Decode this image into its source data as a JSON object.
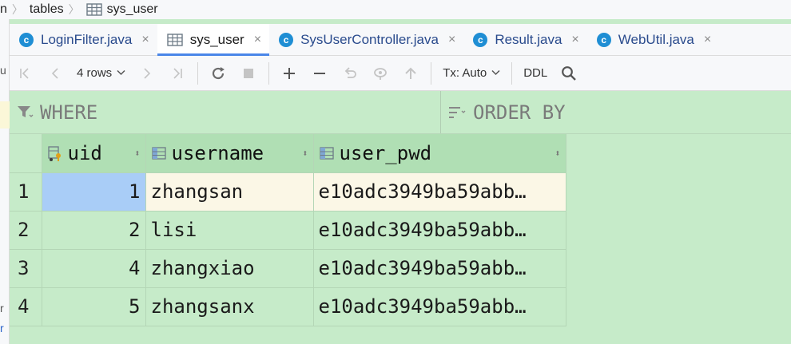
{
  "breadcrumb": {
    "items": [
      "n",
      "tables",
      "sys_user"
    ]
  },
  "tabs": [
    {
      "label": "LoginFilter.java",
      "icon": "c-class-icon",
      "active": false
    },
    {
      "label": "sys_user",
      "icon": "table-icon",
      "active": true
    },
    {
      "label": "SysUserController.java",
      "icon": "c-class-icon",
      "active": false
    },
    {
      "label": "Result.java",
      "icon": "c-class-icon",
      "active": false
    },
    {
      "label": "WebUtil.java",
      "icon": "c-class-icon",
      "active": false
    }
  ],
  "tab_icon_letter": "c",
  "tab_close": "×",
  "toolbar": {
    "rows_label": "4 rows",
    "tx_label": "Tx: Auto",
    "ddl_label": "DDL"
  },
  "filter": {
    "where_label": "WHERE",
    "order_label": "ORDER BY"
  },
  "table": {
    "columns": [
      "uid",
      "username",
      "user_pwd"
    ],
    "rows": [
      {
        "num": "1",
        "uid": "1",
        "username": "zhangsan",
        "user_pwd": "e10adc3949ba59abb…"
      },
      {
        "num": "2",
        "uid": "2",
        "username": "lisi",
        "user_pwd": "e10adc3949ba59abb…"
      },
      {
        "num": "3",
        "uid": "4",
        "username": "zhangxiao",
        "user_pwd": "e10adc3949ba59abb…"
      },
      {
        "num": "4",
        "uid": "5",
        "username": "zhangsanx",
        "user_pwd": "e10adc3949ba59abb…"
      }
    ],
    "selected_row": 1
  },
  "left_strip_fragments": [
    "u",
    "r",
    "r"
  ],
  "colors": {
    "grid_bg": "#c6ebc9",
    "header_bg": "#b0dfb4",
    "selected_cell": "#a9cdf7",
    "accent": "#4a86e8"
  }
}
